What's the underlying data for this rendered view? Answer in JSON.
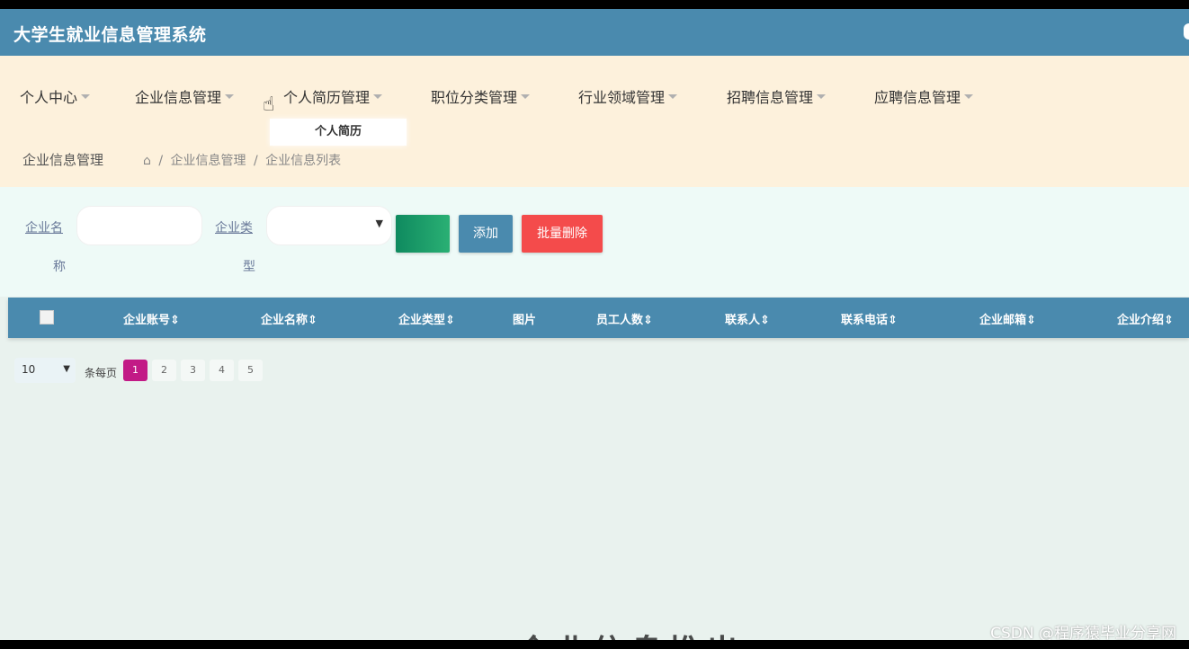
{
  "app": {
    "title": "大学生就业信息管理系统"
  },
  "nav": {
    "items": [
      {
        "label": "个人中心"
      },
      {
        "label": "企业信息管理"
      },
      {
        "label": "个人简历管理"
      },
      {
        "label": "职位分类管理"
      },
      {
        "label": "行业领域管理"
      },
      {
        "label": "招聘信息管理"
      },
      {
        "label": "应聘信息管理"
      }
    ],
    "dropdown": {
      "item": "个人简历"
    }
  },
  "breadcrumb": {
    "page_title": "企业信息管理",
    "path": [
      "企业信息管理",
      "企业信息列表"
    ],
    "separator": "/"
  },
  "search": {
    "company_name_label_1": "企业名",
    "company_name_label_2": "称",
    "company_name_value": "",
    "company_type_label_1": "企业类",
    "company_type_label_2": "型",
    "company_type_value": "",
    "search_label": "",
    "add_label": "添加",
    "batch_delete_label": "批量删除"
  },
  "table": {
    "columns": [
      "企业账号",
      "企业名称",
      "企业类型",
      "图片",
      "员工人数",
      "联系人",
      "联系电话",
      "企业邮箱",
      "企业介绍"
    ],
    "sortable": [
      true,
      true,
      true,
      false,
      true,
      true,
      true,
      true,
      true
    ],
    "rows": []
  },
  "pagination": {
    "page_size": "10",
    "per_page_label": "条每页",
    "pages": [
      "1",
      "2",
      "3",
      "4",
      "5"
    ],
    "current": "1"
  },
  "overlay": {
    "watermark": "CSDN @程序猿毕业分享网",
    "bottom_text": "企业信息推出"
  },
  "colors": {
    "primary": "#4a8aae",
    "nav_bg": "#fdf1dc",
    "search_bg": "#eefaf7",
    "danger": "#f44b4b",
    "active_page": "#c21a86"
  }
}
